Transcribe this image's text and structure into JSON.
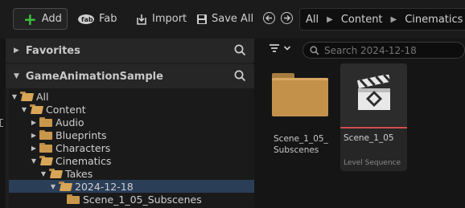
{
  "toolbar": {
    "add_label": "Add",
    "fab_label": "Fab",
    "import_label": "Import",
    "save_all_label": "Save All"
  },
  "breadcrumb": [
    "All",
    "Content",
    "Cinematics"
  ],
  "sections": {
    "favorites": "Favorites",
    "project": "GameAnimationSample"
  },
  "tree": [
    {
      "label": "All",
      "expanded": true
    },
    {
      "label": "Content",
      "expanded": true
    },
    {
      "label": "Audio",
      "expanded": false
    },
    {
      "label": "Blueprints",
      "expanded": false
    },
    {
      "label": "Characters",
      "expanded": false
    },
    {
      "label": "Cinematics",
      "expanded": true
    },
    {
      "label": "Takes",
      "expanded": true
    },
    {
      "label": "2024-12-18",
      "expanded": true,
      "selected": true
    },
    {
      "label": "Scene_1_05_Subscenes",
      "expanded": false
    }
  ],
  "search": {
    "placeholder": "Search 2024-12-18"
  },
  "assets": {
    "folder": {
      "line1": "Scene_1_05_",
      "line2": "Subscenes"
    },
    "sequence": {
      "name": "Scene_1_05",
      "type": "Level Sequence"
    }
  },
  "colors": {
    "accent_green": "#3dc43d",
    "selection": "#2a3e58",
    "folder": "#c9974b",
    "sequence_red": "#d24e4e"
  }
}
